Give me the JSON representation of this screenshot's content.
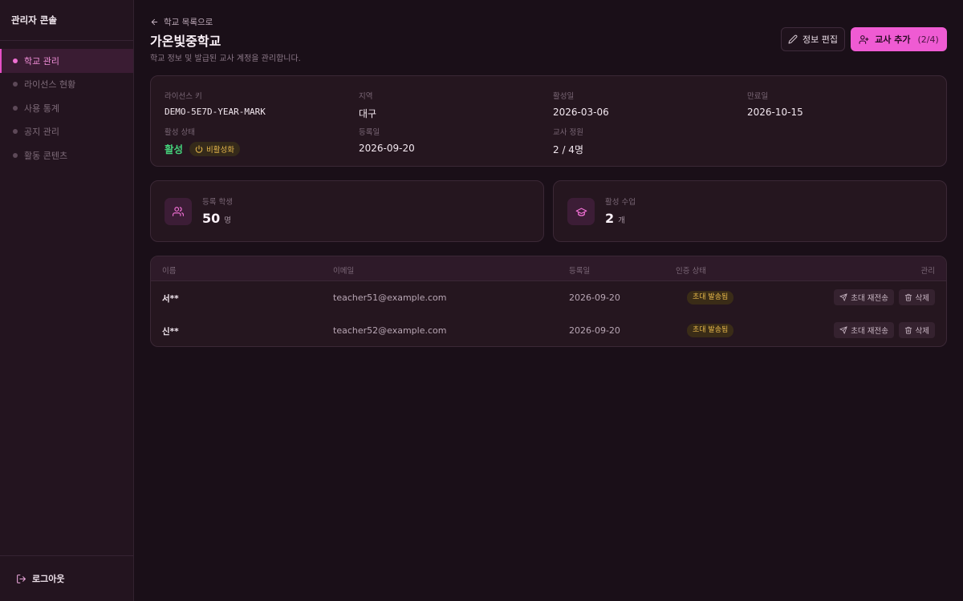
{
  "sidebar": {
    "brand": "관리자 콘솔",
    "items": [
      {
        "label": "학교 관리",
        "active": true
      },
      {
        "label": "라이선스 현황",
        "active": false
      },
      {
        "label": "사용 통계",
        "active": false
      },
      {
        "label": "공지 관리",
        "active": false
      },
      {
        "label": "활동 콘텐츠",
        "active": false
      }
    ],
    "logout": "로그아웃"
  },
  "header": {
    "back": "학교 목록으로",
    "title": "가온빛중학교",
    "subtitle": "학교 정보 및 발급된 교사 계정을 관리합니다.",
    "edit_label": "정보 편집",
    "add_label": "교사 추가",
    "add_count": "(2/4)"
  },
  "info": {
    "license_key_label": "라이선스 키",
    "license_key": "DEMO-5E7D-YEAR-MARK",
    "region_label": "지역",
    "region": "대구",
    "activated_label": "활성일",
    "activated": "2026-03-06",
    "expires_label": "만료일",
    "expires": "2026-10-15",
    "status_label": "활성 상태",
    "status": "활성",
    "deactivate_label": "비활성화",
    "registered_label": "등록일",
    "registered": "2026-09-20",
    "teacher_quota_label": "교사 정원",
    "teacher_quota": "2 / 4명"
  },
  "stats": {
    "students_label": "등록 학생",
    "students_value": "50",
    "students_unit": "명",
    "classes_label": "활성 수업",
    "classes_value": "2",
    "classes_unit": "개"
  },
  "table": {
    "headers": {
      "name": "이름",
      "email": "이메일",
      "date": "등록일",
      "status": "인증 상태",
      "manage": "관리"
    },
    "rows": [
      {
        "name": "서**",
        "email": "teacher51@example.com",
        "date": "2026-09-20",
        "status": "초대 발송됨",
        "resend": "초대 재전송",
        "delete": "삭제"
      },
      {
        "name": "신**",
        "email": "teacher52@example.com",
        "date": "2026-09-20",
        "status": "초대 발송됨",
        "resend": "초대 재전송",
        "delete": "삭제"
      }
    ]
  },
  "colors": {
    "accent": "#ef5bd3",
    "active_status": "#44d07a",
    "warning": "#e5b64a",
    "background": "#1a0f18"
  },
  "icons": [
    "arrow-left-icon",
    "pencil-icon",
    "user-plus-icon",
    "power-icon",
    "users-icon",
    "graduation-cap-icon",
    "send-icon",
    "trash-icon",
    "logout-icon"
  ]
}
